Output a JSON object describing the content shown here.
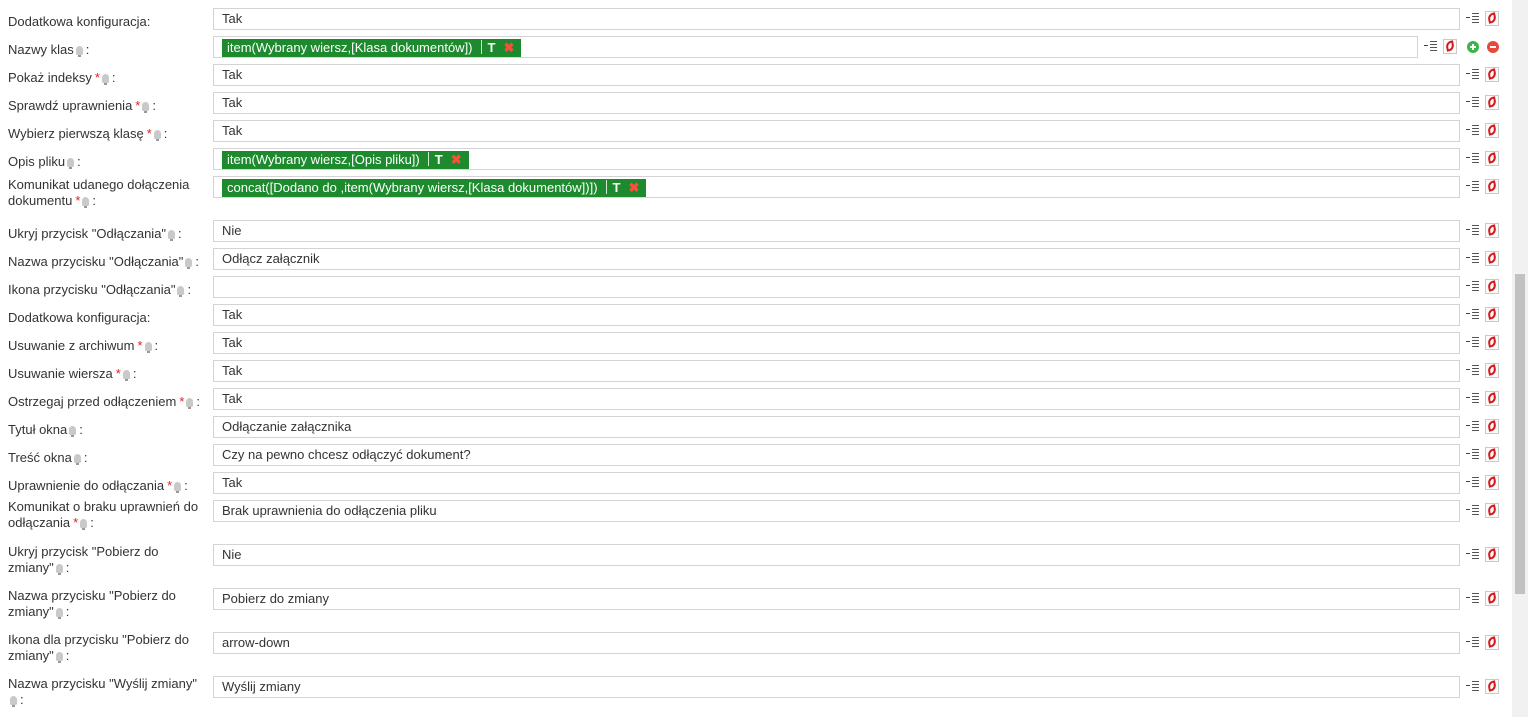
{
  "rows": [
    {
      "label": "Dodatkowa konfiguracja:",
      "required": false,
      "hint": false,
      "value": "Tak"
    },
    {
      "label": "Nazwy klas",
      "required": false,
      "hint": true,
      "value": "",
      "token": {
        "text": "item(Wybrany wiersz,[Klasa dokumentów])",
        "flag": "T"
      },
      "extra_buttons": true
    },
    {
      "label": "Pokaż indeksy",
      "required": true,
      "hint": true,
      "value": "Tak"
    },
    {
      "label": "Sprawdź uprawnienia",
      "required": true,
      "hint": true,
      "value": "Tak"
    },
    {
      "label": "Wybierz pierwszą klasę",
      "required": true,
      "hint": true,
      "value": "Tak"
    },
    {
      "label": "Opis pliku",
      "required": false,
      "hint": true,
      "value": "",
      "token": {
        "text": "item(Wybrany wiersz,[Opis pliku])",
        "flag": "T"
      }
    },
    {
      "label": "Komunikat udanego dołączenia dokumentu",
      "required": true,
      "hint": true,
      "value": "",
      "token": {
        "text": "concat([Dodano do ,item(Wybrany wiersz,[Klasa dokumentów])])",
        "flag": "T"
      }
    },
    {
      "label": "Ukryj przycisk \"Odłączania\"",
      "required": false,
      "hint": true,
      "value": "Nie"
    },
    {
      "label": "Nazwa przycisku \"Odłączania\"",
      "required": false,
      "hint": true,
      "value": "Odłącz załącznik"
    },
    {
      "label": "Ikona przycisku \"Odłączania\"",
      "required": false,
      "hint": true,
      "value": ""
    },
    {
      "label": "Dodatkowa konfiguracja:",
      "required": false,
      "hint": false,
      "value": "Tak"
    },
    {
      "label": "Usuwanie z archiwum",
      "required": true,
      "hint": true,
      "value": "Tak"
    },
    {
      "label": "Usuwanie wiersza",
      "required": true,
      "hint": true,
      "value": "Tak"
    },
    {
      "label": "Ostrzegaj przed odłączeniem",
      "required": true,
      "hint": true,
      "value": "Tak"
    },
    {
      "label": "Tytuł okna",
      "required": false,
      "hint": true,
      "value": "Odłączanie załącznika"
    },
    {
      "label": "Treść okna",
      "required": false,
      "hint": true,
      "value": "Czy na pewno chcesz odłączyć dokument?"
    },
    {
      "label": "Uprawnienie do odłączania",
      "required": true,
      "hint": true,
      "value": "Tak"
    },
    {
      "label": "Komunikat o braku uprawnień do odłączania",
      "required": true,
      "hint": true,
      "value": "Brak uprawnienia do odłączenia pliku"
    },
    {
      "label": "Ukryj przycisk \"Pobierz do zmiany\"",
      "required": false,
      "hint": true,
      "value": "Nie"
    },
    {
      "label": "Nazwa przycisku \"Pobierz do zmiany\"",
      "required": false,
      "hint": true,
      "value": "Pobierz do zmiany"
    },
    {
      "label": "Ikona dla przycisku \"Pobierz do zmiany\"",
      "required": false,
      "hint": true,
      "value": "arrow-down"
    },
    {
      "label": "Nazwa przycisku \"Wyślij zmiany\"",
      "required": false,
      "hint": true,
      "value": "Wyślij zmiany"
    }
  ],
  "icons": {
    "list": "list-icon",
    "pdf": "pdf-icon",
    "add": "add-circle-icon",
    "remove": "remove-circle-icon",
    "hint": "lightbulb-icon"
  },
  "colors": {
    "token_bg": "#1e8a2e",
    "token_remove": "#ff4d3d",
    "required": "#e02020",
    "add": "#39b54a",
    "remove": "#e64a3c"
  },
  "scroll": {
    "position": 0.53,
    "visible": 0.47
  }
}
